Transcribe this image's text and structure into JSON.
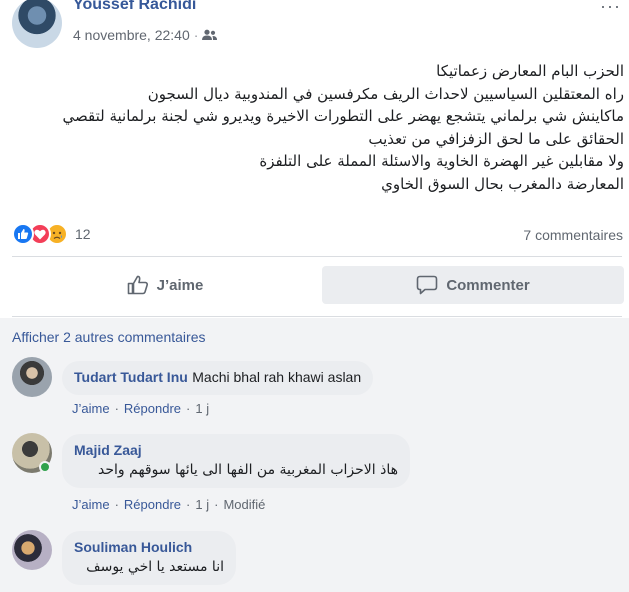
{
  "post": {
    "author": "Youssef Rachidi",
    "time": "4 novembre, 22:40",
    "separator": "·",
    "audience_icon": "friends-icon",
    "more": "···",
    "lines": [
      "الحزب البام المعارض زعماتيكا",
      "راه المعتقلين السياسيين لاحداث الريف مكرفسين في المندوبية ديال السجون",
      "ماكاينش شي برلماني يتشجع يهضر على التطورات الاخيرة ويديرو شي لجنة برلمانية لتقصي",
      "الحقائق على ما لحق الزفزافي من تعذيب",
      "ولا مقابلين غير الهضرة الخاوية والاسئلة المملة على التلفزة",
      "المعارضة دالمغرب بحال السوق الخاوي"
    ]
  },
  "reactions": {
    "count": "12",
    "comments_label": "7 commentaires",
    "icons": [
      "like-icon",
      "love-icon",
      "sad-icon"
    ]
  },
  "actions": {
    "like_label": "J’aime",
    "comment_label": "Commenter"
  },
  "comments_section": {
    "view_more": "Afficher 2 autres commentaires",
    "like_label": "J’aime",
    "reply_label": "Répondre",
    "items": [
      {
        "author": "Tudart Tudart Inu",
        "text": "Machi bhal rah khawi aslan",
        "time": "1 j",
        "edited": ""
      },
      {
        "author": "Majid Zaaj",
        "text": "هاذ الاحزاب المغربية من الفها الى يائها سوقهم واحد",
        "time": "1 j",
        "edited": "Modifié"
      },
      {
        "author": "Souliman Houlich",
        "text": "انا مستعد يا اخي يوسف",
        "time": "",
        "edited": ""
      }
    ]
  },
  "colors": {
    "link": "#385898",
    "author": "#365899",
    "secondary": "#606770",
    "like": "#1877f2",
    "love": "#f33e58",
    "sad": "#f7b125"
  }
}
